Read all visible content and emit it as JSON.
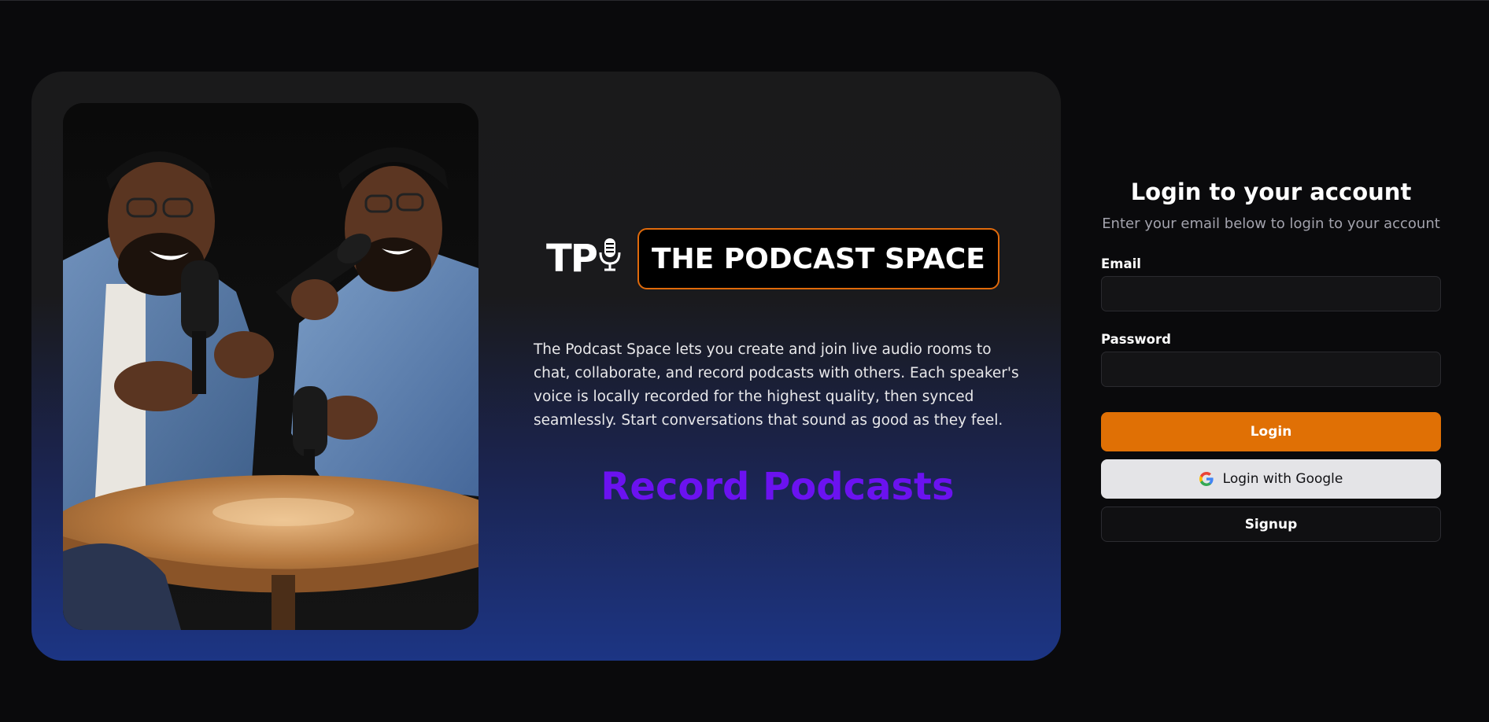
{
  "hero": {
    "logo_text": "TP",
    "brand_title": "THE PODCAST SPACE",
    "description": "The Podcast Space lets you create and join live audio rooms to chat, collaborate, and record podcasts with others. Each speaker's voice is locally recorded for the highest quality, then synced seamlessly. Start conversations that sound as good as they feel.",
    "tagline": "Record Podcasts"
  },
  "login": {
    "title": "Login to your account",
    "subtitle": "Enter your email below to login to your account",
    "email_label": "Email",
    "email_value": "",
    "password_label": "Password",
    "password_value": "",
    "login_button": "Login",
    "google_button": "Login with Google",
    "signup_button": "Signup"
  },
  "colors": {
    "accent_orange": "#e07005",
    "tagline_purple": "#6b12f0",
    "background": "#0a0a0c",
    "card_gradient_bottom": "#1c3584"
  },
  "icons": {
    "logo": "microphone-icon",
    "google": "google-icon"
  }
}
